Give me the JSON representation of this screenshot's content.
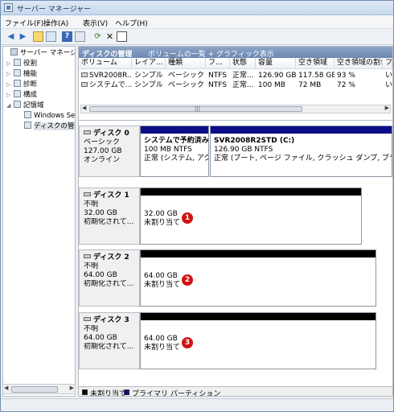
{
  "window": {
    "title": "サーバー マネージャー"
  },
  "menu": [
    "ファイル(F)",
    "操作(A)",
    "表示(V)",
    "ヘルプ(H)"
  ],
  "toolbar_icons": [
    "back-arrow-icon",
    "forward-arrow-icon",
    "up-folder-icon",
    "show-tree-icon",
    "help-icon",
    "properties-icon",
    "refresh-icon",
    "delete-icon",
    "options-icon"
  ],
  "nav": {
    "items": [
      {
        "label": "サーバー マネージャー",
        "icon": "server-icon"
      },
      {
        "label": "役割",
        "icon": "roles-icon"
      },
      {
        "label": "機能",
        "icon": "features-icon"
      },
      {
        "label": "診断",
        "icon": "diagnostics-icon"
      },
      {
        "label": "構成",
        "icon": "configuration-icon"
      },
      {
        "label": "記憶域",
        "icon": "storage-icon"
      },
      {
        "label": "Windows Server",
        "icon": "backup-icon"
      },
      {
        "label": "ディスクの管理",
        "icon": "disk-management-icon"
      }
    ]
  },
  "content": {
    "header_title": "ディスクの管理",
    "header_subtitle": "ボリュームの一覧 + グラフィック表示",
    "columns": [
      "ボリューム",
      "レイア...",
      "種類",
      "フ...",
      "状態",
      "容量",
      "空き領域",
      "空き領域の割合",
      "フ"
    ],
    "rows": [
      [
        "SVR2008R...",
        "シンプル",
        "ベーシック",
        "NTFS",
        "正常...",
        "126.90 GB",
        "117.58 GB",
        "93 %",
        "い"
      ],
      [
        "システムで...",
        "シンプル",
        "ベーシック",
        "NTFS",
        "正常...",
        "100 MB",
        "72 MB",
        "72 %",
        "い"
      ]
    ]
  },
  "disks": [
    {
      "name": "ディスク 0",
      "type": "ベーシック",
      "size": "127.00 GB",
      "status": "オンライン",
      "partitions": [
        {
          "title": "システムで予約済み",
          "size": "100 MB NTFS",
          "status": "正常 (システム, アクテ"
        },
        {
          "title": "SVR2008R2STD  (C:)",
          "size": "126.90 GB NTFS",
          "status": "正常 (ブート, ページ ファイル, クラッシュ ダンプ, プライマ"
        }
      ]
    },
    {
      "name": "ディスク 1",
      "type": "不明",
      "size": "32.00 GB",
      "status": "初期化されて...",
      "unalloc_size": "32.00 GB",
      "unalloc_label": "未割り当て",
      "marker": "1"
    },
    {
      "name": "ディスク 2",
      "type": "不明",
      "size": "64.00 GB",
      "status": "初期化されて...",
      "unalloc_size": "64.00 GB",
      "unalloc_label": "未割り当て",
      "marker": "2"
    },
    {
      "name": "ディスク 3",
      "type": "不明",
      "size": "64.00 GB",
      "status": "初期化されて...",
      "unalloc_size": "64.00 GB",
      "unalloc_label": "未割り当て",
      "marker": "3"
    }
  ],
  "legend": {
    "unallocated": "未割り当て",
    "primary": "プライマリ パーティション",
    "unallocated_color": "#000000",
    "primary_color": "#0a0c88"
  },
  "scrollbar": {
    "grip": "|||"
  }
}
